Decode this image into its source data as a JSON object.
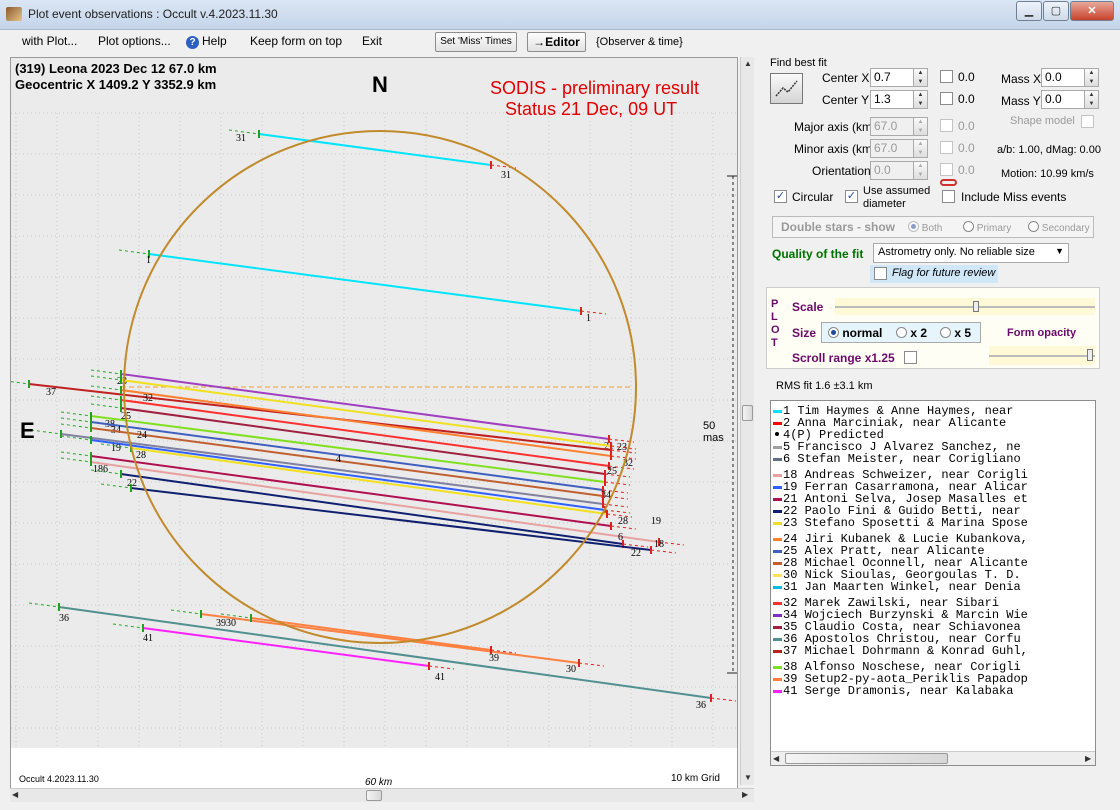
{
  "window": {
    "title": "Plot event observations : Occult v.4.2023.11.30"
  },
  "menu": {
    "with_plot": "with Plot...",
    "plot_options": "Plot options...",
    "help": "Help",
    "keep_on_top": "Keep form on top",
    "exit": "Exit",
    "set_miss_times": "Set 'Miss' Times",
    "editor": "→Editor",
    "observer_time": "{Observer & time}"
  },
  "plot": {
    "header_line1": "(319) Leona  2023 Dec 12   67.0 km",
    "header_line2": "Geocentric  X  1409.2  Y 3352.9 km",
    "north": "N",
    "east": "E",
    "sodis_line1": "SODIS - preliminary result",
    "sodis_line2": "Status 21 Dec, 09 UT",
    "scale_label": "50 mas",
    "footer_version": "Occult 4.2023.11.30",
    "footer_scale": "60 km",
    "footer_grid": "10 km Grid",
    "ellipse_color": "#c18a2a"
  },
  "fit": {
    "find_best_fit": "Find best fit",
    "center_x_label": "Center X",
    "center_x": "0.7",
    "center_y_label": "Center Y",
    "center_y": "1.3",
    "major_label": "Major axis (km)",
    "major": "67.0",
    "minor_label": "Minor axis (km)",
    "minor": "67.0",
    "orient_label": "Orientation",
    "orient": "0.0",
    "zero": "0.0",
    "mass_x_label": "Mass X",
    "mass_x": "0.0",
    "mass_y_label": "Mass Y",
    "mass_y": "0.0",
    "shape_model": "Shape model",
    "ab_text": "a/b: 1.00, dMag: 0.00",
    "motion_text": "Motion: 10.99 km/s",
    "circular": "Circular",
    "use_assumed": "Use assumed",
    "diameter": "diameter",
    "include_miss": "Include Miss events",
    "double_stars": "Double stars - show",
    "both": "Both",
    "primary": "Primary",
    "secondary": "Secondary",
    "quality_label": "Quality of the fit",
    "quality_value": "Astrometry only. No reliable size",
    "flag_review": "Flag for future review"
  },
  "plotpanel": {
    "side_letters": [
      "P",
      "L",
      "O",
      "T"
    ],
    "scale": "Scale",
    "size": "Size",
    "normal": "normal",
    "x2": "x 2",
    "x5": "x 5",
    "form_opacity": "Form opacity",
    "scroll_range": "Scroll range x1.25",
    "rms": "RMS fit  1.6 ±3.1 km"
  },
  "observers": [
    {
      "c": "#00e5ff",
      "t": "   1     Tim Haymes & Anne Haymes, near"
    },
    {
      "c": "#ff0000",
      "t": "   2     Anna Marciniak, near Alicante"
    },
    {
      "c": "dot",
      "t": "   4(P)  Predicted"
    },
    {
      "c": "#a0a0a0",
      "t": "   5     Francisco J Alvarez Sanchez, ne"
    },
    {
      "c": "#607080",
      "t": "   6     Stefan Meister, near Corigliano"
    },
    {
      "c": "gap"
    },
    {
      "c": "#e8a0a0",
      "t": "  18     Andreas Schweizer, near Corigli"
    },
    {
      "c": "#3060ff",
      "t": "  19     Ferran Casarramona, near Alicar"
    },
    {
      "c": "#b01050",
      "t": "  21     Antoni Selva, Josep Masalles et"
    },
    {
      "c": "#102070",
      "t": "  22     Paolo Fini & Guido Betti, near"
    },
    {
      "c": "#f0e020",
      "t": "  23     Stefano Sposetti & Marina Spose"
    },
    {
      "c": "gap"
    },
    {
      "c": "#ff8030",
      "t": "  24     Jiri Kubanek & Lucie Kubankova,"
    },
    {
      "c": "#4060c0",
      "t": "  25     Alex Pratt, near Alicante"
    },
    {
      "c": "#c06030",
      "t": "  28     Michael Oconnell, near Alicante"
    },
    {
      "c": "#ffe060",
      "t": "  30     Nick Sioulas, Georgoulas T. D."
    },
    {
      "c": "#00c0e0",
      "t": "  31     Jan Maarten Winkel, near Denia"
    },
    {
      "c": "gap"
    },
    {
      "c": "#ff3030",
      "t": "  32     Marek Zawilski, near Sibari"
    },
    {
      "c": "#8030c0",
      "t": "  34     Wojciech Burzynski & Marcin Wie"
    },
    {
      "c": "#a02040",
      "t": "  35     Claudio Costa, near Schiavonea"
    },
    {
      "c": "#509090",
      "t": "  36     Apostolos Christou, near Corfu"
    },
    {
      "c": "#c02020",
      "t": "  37     Michael Dohrmann & Konrad Guhl,"
    },
    {
      "c": "gap"
    },
    {
      "c": "#80e020",
      "t": "  38     Alfonso Noschese, near Corigli"
    },
    {
      "c": "#ff8040",
      "t": "  39     Setup2-py-aota_Periklis Papadop"
    },
    {
      "c": "#ff20ff",
      "t": "  41     Serge Dramonis, near Kalabaka"
    }
  ]
}
